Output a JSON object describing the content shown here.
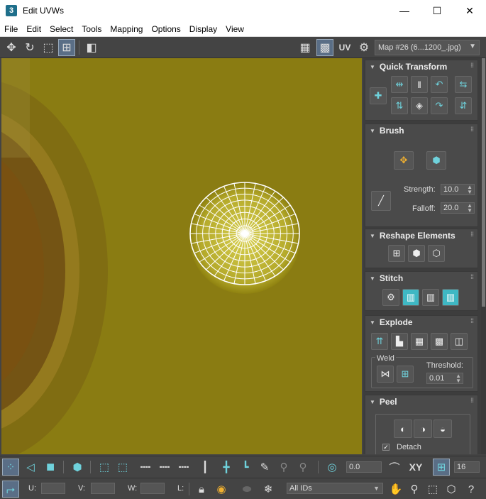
{
  "window": {
    "title": "Edit UVWs",
    "app_icon": "3",
    "minimize": "—",
    "maximize": "☐",
    "close": "✕"
  },
  "menu": [
    "File",
    "Edit",
    "Select",
    "Tools",
    "Mapping",
    "Options",
    "Display",
    "View"
  ],
  "toolbar": {
    "uv_label": "UV",
    "map_select": "Map #26 (6...1200_.jpg)"
  },
  "panel": {
    "quick_transform": {
      "title": "Quick Transform"
    },
    "brush": {
      "title": "Brush",
      "strength_label": "Strength:",
      "strength_value": "10.0",
      "falloff_label": "Falloff:",
      "falloff_value": "20.0"
    },
    "reshape": {
      "title": "Reshape Elements"
    },
    "stitch": {
      "title": "Stitch"
    },
    "explode": {
      "title": "Explode",
      "weld_label": "Weld",
      "threshold_label": "Threshold:",
      "threshold_value": "0.01"
    },
    "peel": {
      "title": "Peel",
      "detach_label": "Detach"
    }
  },
  "bottom": {
    "angle_value": "0.0",
    "xy_label": "XY",
    "grid_value": "16",
    "u_label": "U:",
    "v_label": "V:",
    "w_label": "W:",
    "l_label": "L:",
    "ids_select": "All IDs"
  },
  "colors": {
    "background": "#8a7a10",
    "accent": "#3fb8c4",
    "panel": "#4a4a4a"
  }
}
